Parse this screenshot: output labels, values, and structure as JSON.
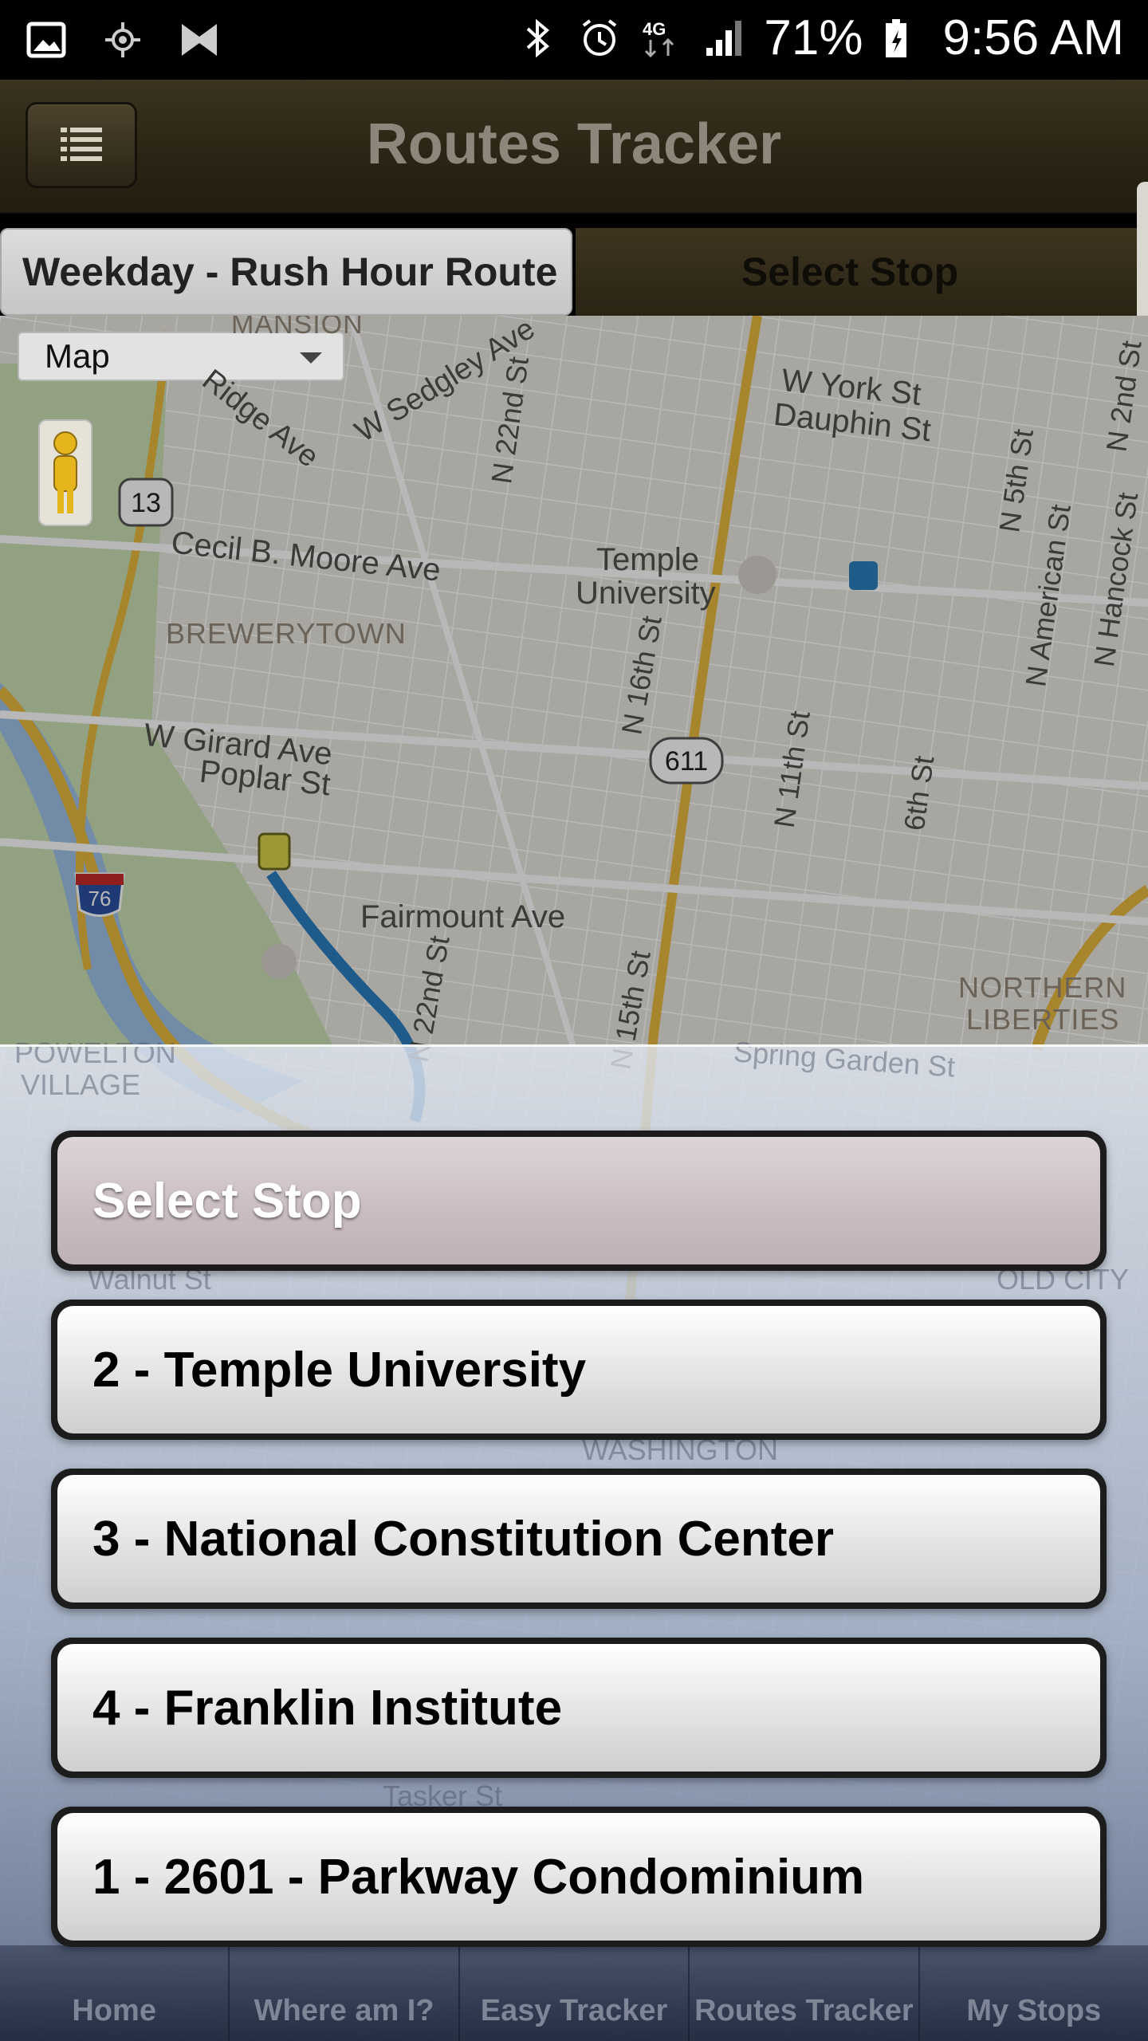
{
  "status_bar": {
    "icons_left": [
      "image-icon",
      "location-icon",
      "app-icon"
    ],
    "icons_right": [
      "bluetooth-icon",
      "alarm-icon",
      "network-4g-icon",
      "signal-icon"
    ],
    "battery_percent": "71%",
    "time": "9:56 AM"
  },
  "header": {
    "menu_icon": "list-icon",
    "title": "Routes Tracker"
  },
  "tabs": {
    "route_label": "Weekday - Rush Hour Route",
    "stop_label": "Select Stop"
  },
  "map": {
    "type_selected": "Map",
    "labels": {
      "mansion": "MANSION",
      "w_sedgley": "W Sedgley Ave",
      "ridge_ave": "Ridge Ave",
      "n_22nd": "N 22nd St",
      "w_york": "W York St",
      "dauphin": "Dauphin St",
      "n_5th": "N 5th St",
      "n_2nd": "N 2nd St",
      "n_american": "N American St",
      "n_hancock": "N Hancock St",
      "route_13": "13",
      "cecil": "Cecil B. Moore Ave",
      "temple": "Temple",
      "university": "University",
      "brewerytown": "BREWERYTOWN",
      "n_16th": "N 16th St",
      "route_611": "611",
      "w_girard": "W Girard Ave",
      "poplar": "Poplar St",
      "n_11th": "N 11th St",
      "sixth": "6th St",
      "route_76": "76",
      "fairmount": "Fairmount Ave",
      "n_22nd_lower": "N 22nd St",
      "n_15th": "N 15th St",
      "northern": "NORTHERN",
      "liberties": "LIBERTIES",
      "powelton": "POWELTON",
      "village": "VILLAGE",
      "spring_garden": "Spring Garden St",
      "walnut": "Walnut St",
      "washington": "WASHINGTON",
      "tasker": "Tasker St",
      "old_city": "OLD CITY"
    }
  },
  "stop_list": {
    "header": "Select Stop",
    "items": [
      "2 - Temple University",
      "3 - National Constitution Center",
      "4 - Franklin Institute",
      "1 - 2601 - Parkway Condominium"
    ]
  },
  "bottom_nav": {
    "items": [
      "Home",
      "Where am I?",
      "Easy Tracker",
      "Routes Tracker",
      "My Stops"
    ]
  },
  "colors": {
    "header_bg": "#2a2414",
    "title_text": "#8d867a",
    "map_bg": "#e9e6df",
    "highway": "#e8b93e",
    "route_line": "#2b7fc0",
    "overlay_top": "#d2d8e2",
    "nav_bg": "#1e263a"
  }
}
